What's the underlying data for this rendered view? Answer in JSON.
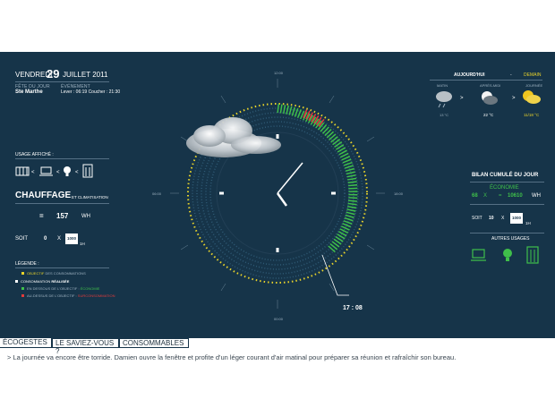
{
  "header": {
    "day": "VENDREDI",
    "date": "29",
    "month_year": "JUILLET 2011",
    "saint_label": "FÊTE DU JOUR",
    "saint": "Ste Marthe",
    "event_label": "ÉVÉNEMENT",
    "sun": "Lever : 06:19  Coucher : 21:30"
  },
  "usage": {
    "label": "USAGE AFFICHÉ :",
    "title": "CHAUFFAGE",
    "subtitle": "ET CLIMATISATION",
    "equals": "=",
    "value": "157",
    "unit": "WH",
    "soit": "SOIT",
    "count": "0",
    "times": "X",
    "badge": "1000",
    "badge_sub": "1H"
  },
  "legend": {
    "title": "LÉGENDE :",
    "items": [
      {
        "text": "OBJECTIF",
        "rest": "DES CONSOMMATIONS"
      },
      {
        "text": "CONSOMMATION",
        "rest": "RÉALISÉE"
      },
      {
        "text": "EN DESSOUS DE L'OBJECTIF :",
        "rest": "ÉCONOMIE"
      },
      {
        "text": "AU-DESSUS DE L'OBJECTIF :",
        "rest": "SURCONSOMMATION"
      }
    ]
  },
  "clock": {
    "top": "12:00",
    "right": "18:00",
    "bottom": "00:00",
    "left": "06:00",
    "time": "17 : 08"
  },
  "weather": {
    "today": "AUJOURD'HUI",
    "sep": "-",
    "tomorrow": "DEMAIN",
    "periods": [
      {
        "label": "MATIN",
        "temp": "13 °C"
      },
      {
        "label": "APRÈS-MIDI",
        "temp": "22 °C"
      },
      {
        "label": "JOURNÉE",
        "temp": "11/18 °C"
      }
    ]
  },
  "bilan": {
    "title": "BILAN CUMULÉ DU JOUR",
    "eco_label": "ÉCONOMIE",
    "eco_count": "68",
    "times": "X",
    "equals": "=",
    "eco_value": "10610",
    "unit": "WH",
    "soit": "SOIT",
    "count": "10",
    "badge": "1000",
    "badge_sub": "1H",
    "others": "AUTRES USAGES"
  },
  "tabs": [
    "ÉCOGESTES",
    "LE SAVIEZ-VOUS ?",
    "CONSOMMABLES"
  ],
  "tip": "> La journée va encore être torride. Damien ouvre la fenêtre et profite d'un léger courant d'air matinal pour préparer sa réunion et rafraîchir son bureau.",
  "colors": {
    "panel": "#163449",
    "green": "#3fbf4a",
    "yellow": "#e8d32a",
    "red": "#e23b3b"
  }
}
